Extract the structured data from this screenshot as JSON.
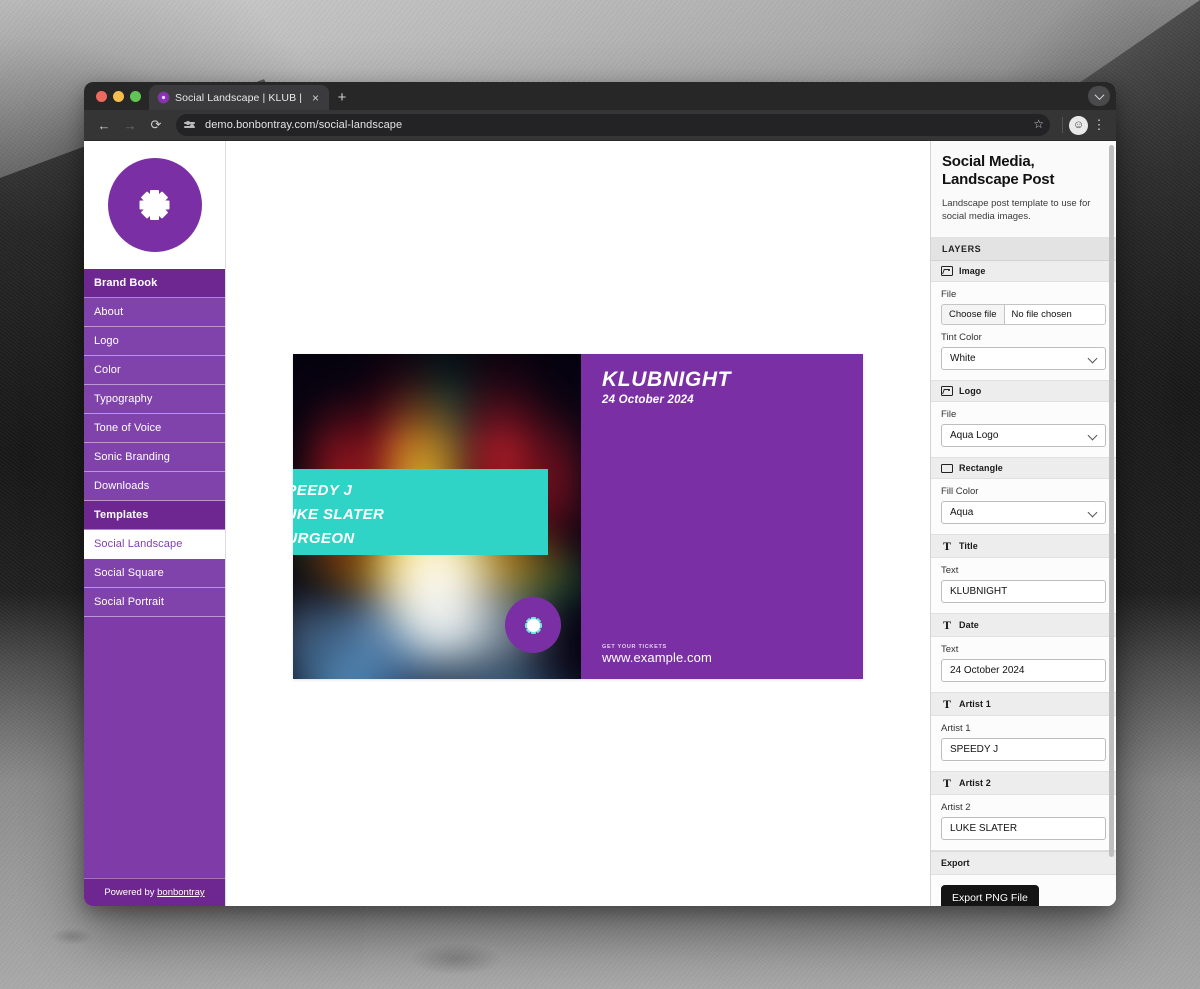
{
  "browser": {
    "tab": {
      "title": "Social Landscape | KLUB | bo",
      "close_label": "×",
      "favicon_name": "klub-favicon"
    },
    "new_tab_label": "+",
    "tabstrip_menu_label": "",
    "nav": {
      "back": "←",
      "forward": "→",
      "reload": "⟳"
    },
    "url": "demo.bonbontray.com/social-landscape",
    "bookmark_label": "☆",
    "profile_label": "☺",
    "menu_label": "⋮"
  },
  "sidebar": {
    "logo_name": "klub-logo-starburst",
    "sections": [
      {
        "type": "header",
        "label": "Brand Book"
      },
      {
        "type": "item",
        "label": "About",
        "active": false
      },
      {
        "type": "item",
        "label": "Logo",
        "active": false
      },
      {
        "type": "item",
        "label": "Color",
        "active": false
      },
      {
        "type": "item",
        "label": "Typography",
        "active": false
      },
      {
        "type": "item",
        "label": "Tone of Voice",
        "active": false
      },
      {
        "type": "item",
        "label": "Sonic Branding",
        "active": false
      },
      {
        "type": "item",
        "label": "Downloads",
        "active": false
      },
      {
        "type": "header",
        "label": "Templates"
      },
      {
        "type": "item",
        "label": "Social Landscape",
        "active": true
      },
      {
        "type": "item",
        "label": "Social Square",
        "active": false
      },
      {
        "type": "item",
        "label": "Social Portrait",
        "active": false
      }
    ],
    "footer": {
      "prefix": "Powered by ",
      "link": "bonbontray"
    }
  },
  "poster": {
    "title": "KLUBNIGHT",
    "date": "24 October 2024",
    "artists": [
      "SPEEDY J",
      "LUKE SLATER",
      "SURGEON"
    ],
    "tickets_label": "GET YOUR TICKETS",
    "url": "www.example.com",
    "logo_name": "klub-logo-aqua",
    "colors": {
      "purple": "#7B2FA5",
      "aqua": "#2FD4C6",
      "text": "#FFFFFF"
    }
  },
  "panel": {
    "title": "Social Media, Landscape Post",
    "description": "Landscape post template to use for social media images.",
    "layers_label": "LAYERS",
    "layers": [
      {
        "name": "Image",
        "icon": "image-icon",
        "fields": [
          {
            "kind": "file",
            "label": "File",
            "button": "Choose file",
            "value": "No file chosen"
          },
          {
            "kind": "select",
            "label": "Tint Color",
            "value": "White"
          }
        ]
      },
      {
        "name": "Logo",
        "icon": "image-icon",
        "fields": [
          {
            "kind": "select",
            "label": "File",
            "value": "Aqua Logo"
          }
        ]
      },
      {
        "name": "Rectangle",
        "icon": "rectangle-icon",
        "fields": [
          {
            "kind": "select",
            "label": "Fill Color",
            "value": "Aqua"
          }
        ]
      },
      {
        "name": "Title",
        "icon": "text-icon",
        "fields": [
          {
            "kind": "text",
            "label": "Text",
            "value": "KLUBNIGHT"
          }
        ]
      },
      {
        "name": "Date",
        "icon": "text-icon",
        "fields": [
          {
            "kind": "text",
            "label": "Text",
            "value": "24 October 2024"
          }
        ]
      },
      {
        "name": "Artist 1",
        "icon": "text-icon",
        "fields": [
          {
            "kind": "text",
            "label": "Artist 1",
            "value": "SPEEDY J"
          }
        ]
      },
      {
        "name": "Artist 2",
        "icon": "text-icon",
        "fields": [
          {
            "kind": "text",
            "label": "Artist 2",
            "value": "LUKE SLATER"
          }
        ]
      }
    ],
    "export": {
      "label": "Export",
      "button": "Export PNG File"
    }
  }
}
